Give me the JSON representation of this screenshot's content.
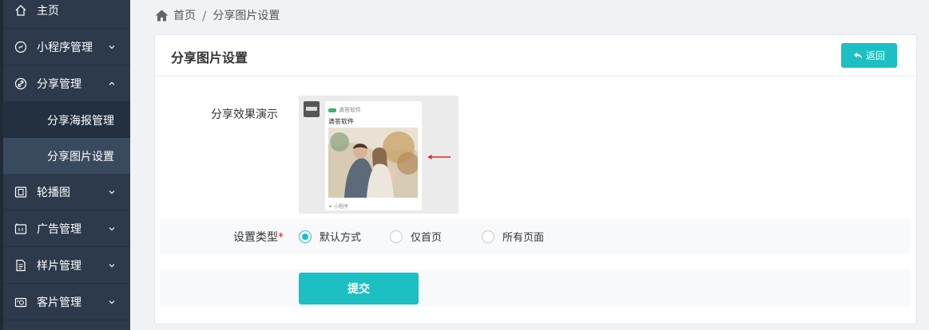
{
  "sidebar": {
    "items": [
      {
        "label": "主页",
        "icon": "home-icon"
      },
      {
        "label": "小程序管理",
        "icon": "miniprogram-icon"
      },
      {
        "label": "分享管理",
        "icon": "link-icon"
      },
      {
        "label": "分享海报管理"
      },
      {
        "label": "分享图片设置"
      },
      {
        "label": "轮播图",
        "icon": "carousel-icon"
      },
      {
        "label": "广告管理",
        "icon": "ad-icon"
      },
      {
        "label": "样片管理",
        "icon": "document-icon"
      },
      {
        "label": "客片管理",
        "icon": "camera-icon"
      }
    ]
  },
  "breadcrumb": {
    "home": "首页",
    "separator": "/",
    "current": "分享图片设置"
  },
  "card": {
    "title": "分享图片设置",
    "back_label": "返回"
  },
  "form": {
    "preview_label": "分享效果演示",
    "preview": {
      "app_name": "滴答软件",
      "share_title": "滴答软件",
      "mini_label": "小程序"
    },
    "type_label": "设置类型",
    "required_mark": "*",
    "options": [
      {
        "label": "默认方式",
        "checked": true
      },
      {
        "label": "仅首页",
        "checked": false
      },
      {
        "label": "所有页面",
        "checked": false
      }
    ],
    "submit_label": "提交"
  },
  "colors": {
    "accent": "#1cc0c3",
    "sidebar_bg": "#2c3a4b",
    "sidebar_active": "#3a4a5e",
    "required": "#e02020"
  }
}
